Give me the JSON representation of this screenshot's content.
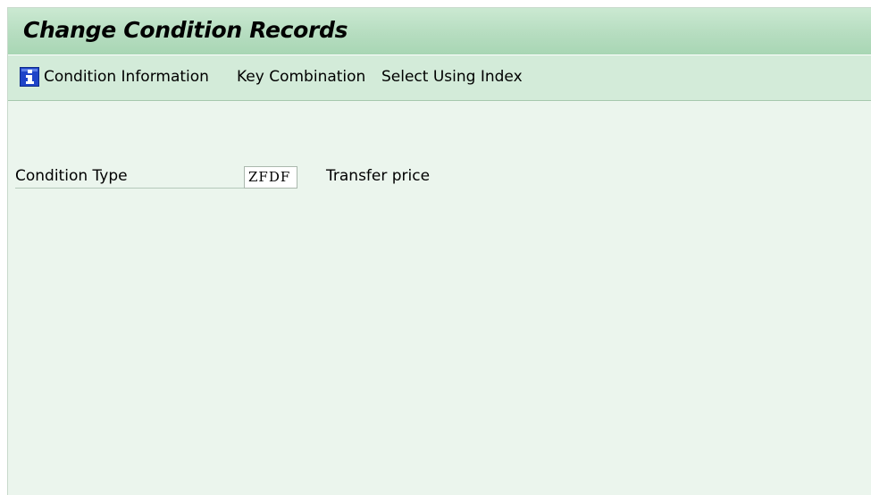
{
  "window": {
    "title": "Change Condition Records"
  },
  "toolbar": {
    "condition_info_icon": "info-icon",
    "condition_info_label": "Condition Information",
    "key_combination_label": "Key Combination",
    "select_using_index_label": "Select Using Index"
  },
  "form": {
    "condition_type_label": "Condition Type",
    "condition_type_value": "ZFDF",
    "condition_type_description": "Transfer price"
  },
  "colors": {
    "title_bar": "#b6ddc0",
    "toolbar": "#d3ebd9",
    "workspace": "#ebf5ed",
    "info_icon_blue": "#1f44c8"
  }
}
